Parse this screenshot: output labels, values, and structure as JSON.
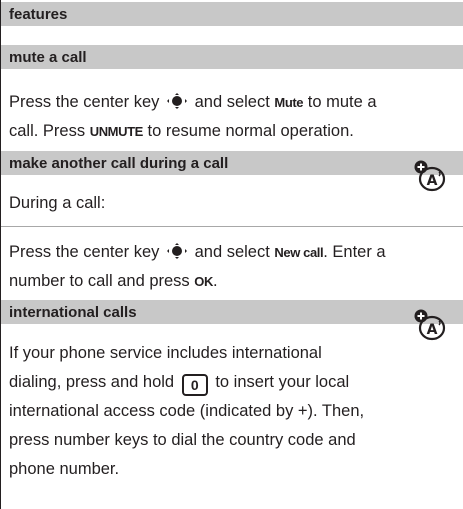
{
  "header": {
    "title": "features"
  },
  "sections": {
    "mute": {
      "title": "mute a call",
      "line1_a": "Press the center key",
      "line1_b": "and select",
      "cmd_mute": "Mute",
      "line1_c": "to mute a",
      "line2_a": "call. Press",
      "cmd_unmute": "UNMUTE",
      "line2_b": "to resume normal operation."
    },
    "another": {
      "title": "make another call during a call",
      "intro": "During a call:",
      "line1_a": "Press the center key",
      "line1_b": "and select",
      "cmd_new": "New call",
      "line1_c": ". Enter a",
      "line2_a": "number to call and press",
      "cmd_ok": "OK",
      "line2_b": "."
    },
    "intl": {
      "title": "international calls",
      "line1": "If your phone service includes international",
      "line2_a": "dialing, press and hold",
      "key0": "0",
      "line2_b": "to insert your local",
      "line3": "international access code (indicated by +). Then,",
      "line4": "press number keys to dial the country code and",
      "line5": "phone number."
    }
  },
  "icons": {
    "center_key": "nav-center-key-icon",
    "network": "network-dependent-feature-icon",
    "key": "zero-key-icon"
  },
  "colors": {
    "header_bg": "#c8c8c8",
    "rule": "#a8a8a8",
    "text": "#231f20"
  }
}
